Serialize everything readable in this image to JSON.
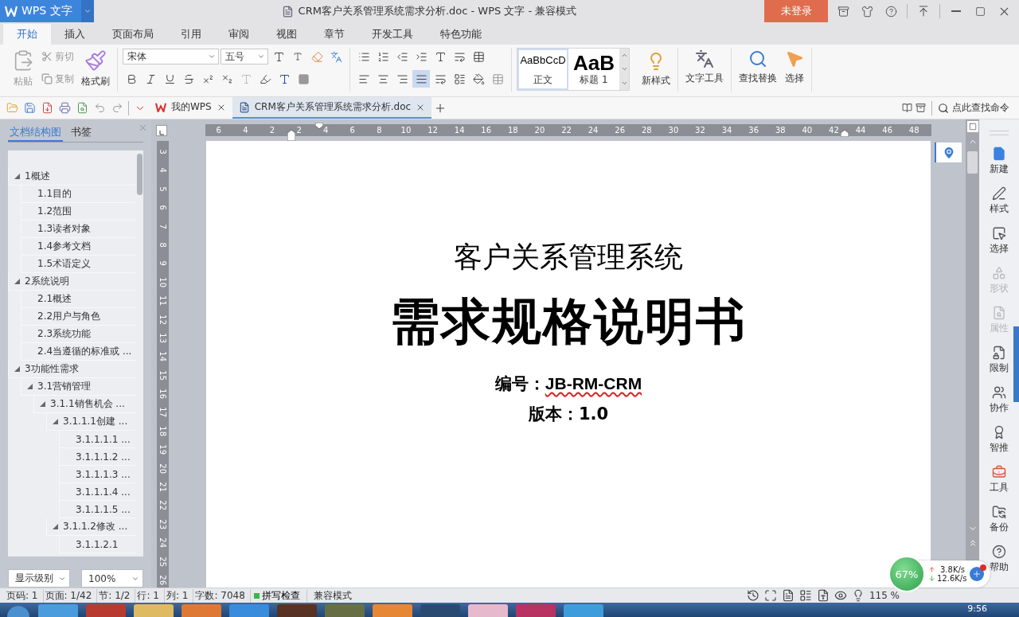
{
  "app_menu": {
    "label": "WPS 文字"
  },
  "window": {
    "title": "CRM客户关系管理系统需求分析.doc - WPS 文字 - 兼容模式"
  },
  "login_button": "未登录",
  "ribbon_tabs": [
    {
      "label": "开始",
      "selected": true
    },
    {
      "label": "插入",
      "selected": false
    },
    {
      "label": "页面布局",
      "selected": false
    },
    {
      "label": "引用",
      "selected": false
    },
    {
      "label": "审阅",
      "selected": false
    },
    {
      "label": "视图",
      "selected": false
    },
    {
      "label": "章节",
      "selected": false
    },
    {
      "label": "开发工具",
      "selected": false
    },
    {
      "label": "特色功能",
      "selected": false
    }
  ],
  "ribbon": {
    "paste": "粘贴",
    "cut": "剪切",
    "copy": "复制",
    "format_painter": "格式刷",
    "font_name": "宋体",
    "font_size": "五号",
    "align_buttons": [
      {
        "kind": "left",
        "selected": false
      },
      {
        "kind": "center",
        "selected": false
      },
      {
        "kind": "right",
        "selected": false
      },
      {
        "kind": "justify",
        "selected": true
      },
      {
        "kind": "distributed",
        "selected": false
      }
    ],
    "styles": [
      {
        "preview": "AaBbCcD",
        "label": "正文",
        "selected": true
      },
      {
        "preview": "AaB",
        "label": "标题 1",
        "selected": false
      }
    ],
    "new_style": "新样式",
    "text_tools": "文字工具",
    "find_replace": "查找替换",
    "select": "选择"
  },
  "doc_tabs": [
    {
      "label": "我的WPS",
      "selected": false
    },
    {
      "label": "CRM客户关系管理系统需求分析.doc",
      "selected": true
    }
  ],
  "command_search": "点此查找命令",
  "nav_panel": {
    "tabs": [
      {
        "label": "文档结构图",
        "selected": true
      },
      {
        "label": "书签",
        "selected": false
      }
    ],
    "outline": [
      {
        "label": "1概述",
        "expanded": true,
        "children": [
          {
            "label": "1.1目的"
          },
          {
            "label": "1.2范围"
          },
          {
            "label": "1.3读者对象"
          },
          {
            "label": "1.4参考文档"
          },
          {
            "label": "1.5术语定义"
          }
        ]
      },
      {
        "label": "2系统说明",
        "expanded": true,
        "children": [
          {
            "label": "2.1概述"
          },
          {
            "label": "2.2用户与角色"
          },
          {
            "label": "2.3系统功能"
          },
          {
            "label": "2.4当遵循的标准或 ..."
          }
        ]
      },
      {
        "label": "3功能性需求",
        "expanded": true,
        "children": [
          {
            "label": "3.1营销管理",
            "expanded": true,
            "children": [
              {
                "label": "3.1.1销售机会 ...",
                "expanded": true,
                "children": [
                  {
                    "label": "3.1.1.1创建 ...",
                    "expanded": true,
                    "children": [
                      {
                        "label": "3.1.1.1.1 ..."
                      },
                      {
                        "label": "3.1.1.1.2 ..."
                      },
                      {
                        "label": "3.1.1.1.3 ..."
                      },
                      {
                        "label": "3.1.1.1.4 ..."
                      },
                      {
                        "label": "3.1.1.1.5 ..."
                      }
                    ]
                  },
                  {
                    "label": "3.1.1.2修改 ...",
                    "expanded": true,
                    "children": [
                      {
                        "label": "3.1.1.2.1"
                      }
                    ]
                  }
                ]
              }
            ]
          }
        ]
      }
    ],
    "level_select": "显示级别",
    "zoom_select": "100%"
  },
  "ruler": {
    "horizontal": [
      "6",
      "4",
      "2",
      "2",
      "4",
      "6",
      "8",
      "10",
      "12",
      "14",
      "16",
      "18",
      "20",
      "22",
      "24",
      "26",
      "28",
      "30",
      "32",
      "34",
      "36",
      "38",
      "40",
      "42",
      "44",
      "46",
      "48"
    ],
    "vertical": [
      "3",
      "4",
      "5",
      "6",
      "7",
      "8",
      "9",
      "10",
      "11",
      "12",
      "13",
      "14",
      "15",
      "16",
      "17",
      "18",
      "19",
      "20",
      "21",
      "22",
      "23",
      "24",
      "25",
      "26"
    ]
  },
  "document": {
    "subtitle": "客户关系管理系统",
    "title": "需求规格说明书",
    "number_label": "编号：",
    "number_value": "JB-RM-CRM",
    "number_misspelled": true,
    "version": "版本：1.0"
  },
  "side_tools": [
    {
      "label": "新建",
      "disabled": false
    },
    {
      "label": "样式",
      "disabled": false
    },
    {
      "label": "选择",
      "disabled": false
    },
    {
      "label": "形状",
      "disabled": true
    },
    {
      "label": "属性",
      "disabled": true
    },
    {
      "label": "限制",
      "disabled": false
    },
    {
      "label": "协作",
      "disabled": false
    },
    {
      "label": "智推",
      "disabled": false
    },
    {
      "label": "工具",
      "disabled": false
    },
    {
      "label": "备份",
      "disabled": false
    },
    {
      "label": "帮助",
      "disabled": false
    }
  ],
  "status_bar": {
    "fields": [
      "页码: 1",
      "页面: 1/42",
      "节: 1/2",
      "行: 1",
      "列: 1",
      "字数: 7048"
    ],
    "spell_check": {
      "label": "拼写检查",
      "on": true
    },
    "mode": "兼容模式",
    "zoom": "115 %"
  },
  "net_widget": {
    "percent": "67%",
    "upload": "3.8K/s",
    "download": "12.6K/s"
  },
  "taskbar": {
    "clock": "9:56"
  }
}
